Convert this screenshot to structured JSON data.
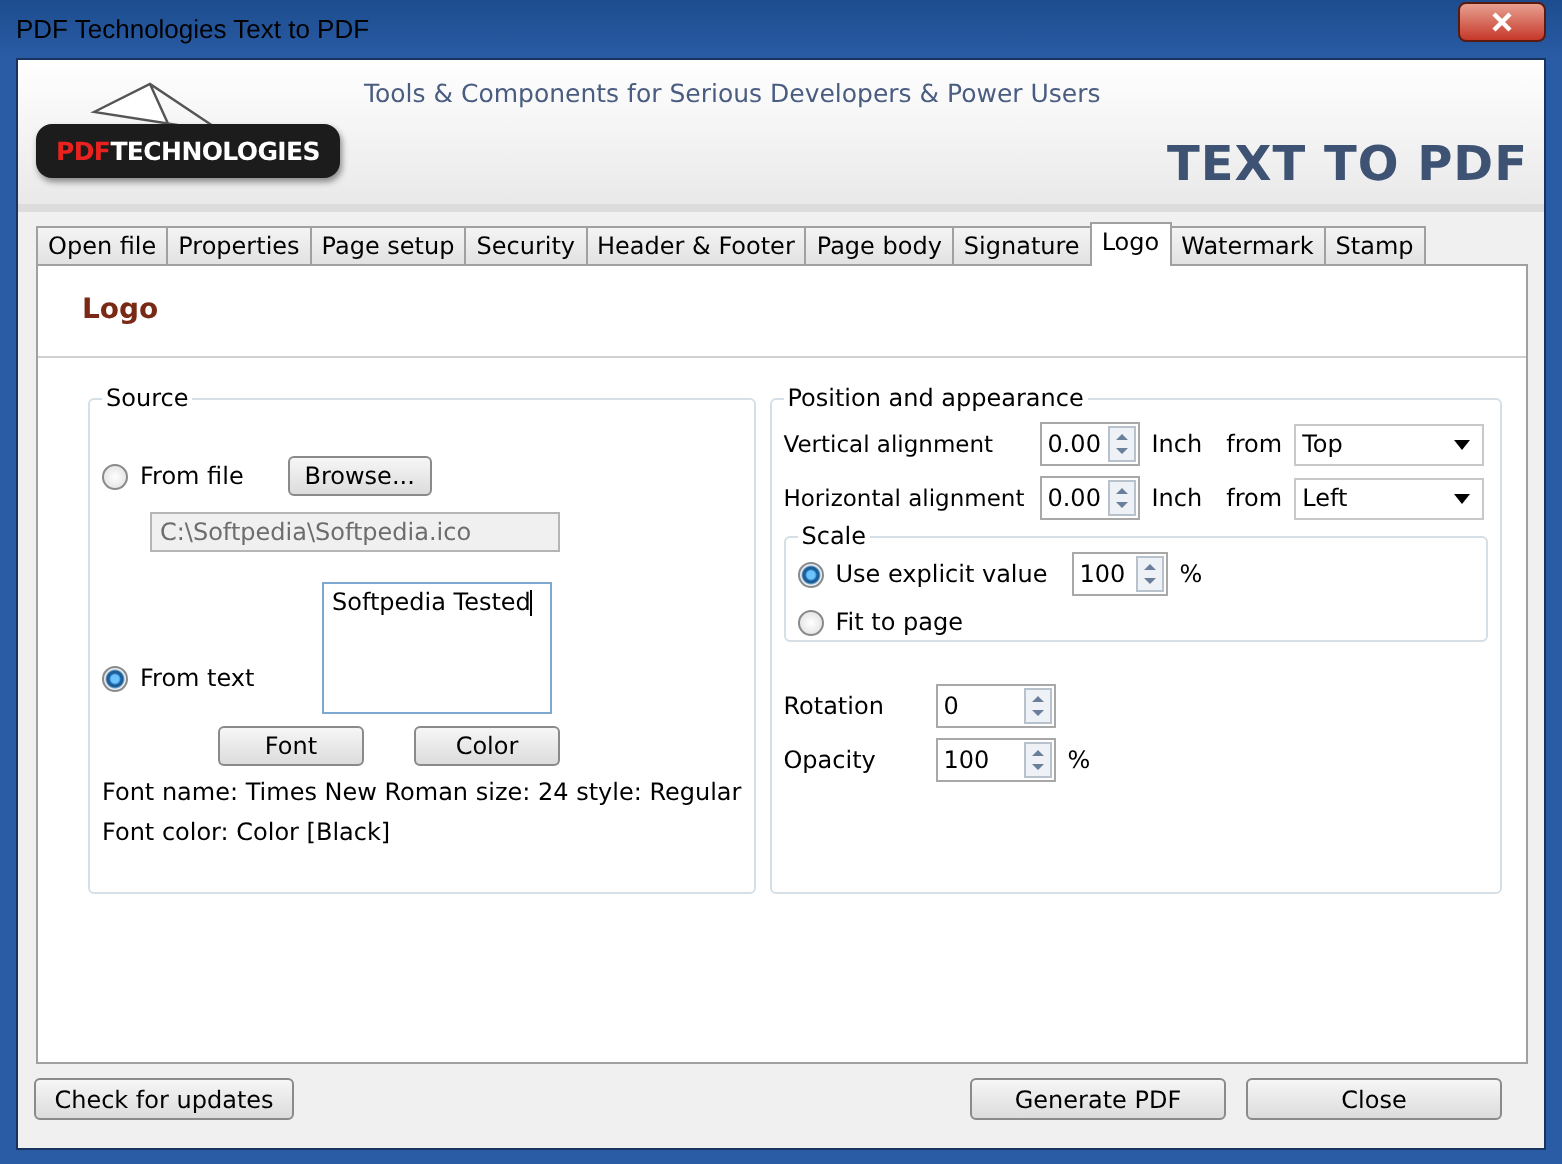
{
  "window": {
    "title": "PDF Technologies Text to PDF"
  },
  "banner": {
    "logo_prefix": "PDF",
    "logo_suffix": "TECHNOLOGIES",
    "tagline": "Tools & Components for Serious Developers & Power Users",
    "product": "TEXT TO PDF"
  },
  "tabs": [
    {
      "label": "Open file",
      "selected": false
    },
    {
      "label": "Properties",
      "selected": false
    },
    {
      "label": "Page setup",
      "selected": false
    },
    {
      "label": "Security",
      "selected": false
    },
    {
      "label": "Header & Footer",
      "selected": false
    },
    {
      "label": "Page body",
      "selected": false
    },
    {
      "label": "Signature",
      "selected": false
    },
    {
      "label": "Logo",
      "selected": true
    },
    {
      "label": "Watermark",
      "selected": false
    },
    {
      "label": "Stamp",
      "selected": false
    }
  ],
  "section_title": "Logo",
  "source": {
    "title": "Source",
    "options": [
      {
        "label": "From file",
        "selected": false
      },
      {
        "label": "From text",
        "selected": true
      }
    ],
    "browse_button": "Browse...",
    "file_path": "C:\\Softpedia\\Softpedia.ico",
    "text_value": "Softpedia Tested",
    "font_button": "Font",
    "color_button": "Color",
    "font_info": "Font name: Times New Roman size: 24 style: Regular",
    "font_color": "Font color: Color [Black]"
  },
  "position": {
    "title": "Position and appearance",
    "rows": [
      {
        "label": "Vertical alignment",
        "value": "0.00",
        "unit": "Inch",
        "from_label": "from",
        "from_value": "Top"
      },
      {
        "label": "Horizontal alignment",
        "value": "0.00",
        "unit": "Inch",
        "from_label": "from",
        "from_value": "Left"
      }
    ],
    "scale": {
      "title": "Scale",
      "options": [
        {
          "label": "Use explicit value",
          "selected": true
        },
        {
          "label": "Fit to page",
          "selected": false
        }
      ],
      "value": "100",
      "unit": "%"
    },
    "rotation": {
      "label": "Rotation",
      "value": "0"
    },
    "opacity": {
      "label": "Opacity",
      "value": "100",
      "unit": "%"
    }
  },
  "footer": {
    "updates_button": "Check for  updates",
    "generate_button": "Generate PDF",
    "close_button": "Close"
  }
}
